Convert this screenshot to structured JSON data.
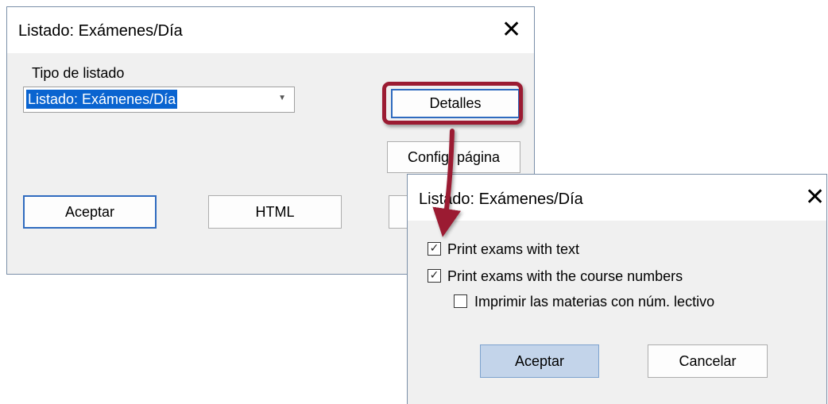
{
  "dialog1": {
    "title": "Listado: Exámenes/Día",
    "close_glyph": "✕",
    "type_label": "Tipo de listado",
    "combo_value": "Listado: Exámenes/Día",
    "combo_arrow": "▼",
    "details_button": "Detalles",
    "config_button": "Config. página",
    "accept_button": "Aceptar",
    "html_button": "HTML"
  },
  "dialog2": {
    "title": "Listado: Exámenes/Día",
    "close_glyph": "✕",
    "options": [
      {
        "label": "Print exams with text",
        "checked": true
      },
      {
        "label": "Print exams with the course numbers",
        "checked": true
      },
      {
        "label": "Imprimir las materias con núm. lectivo",
        "checked": false
      }
    ],
    "accept_button": "Aceptar",
    "cancel_button": "Cancelar"
  },
  "annotation": {
    "color": "#9b1b32",
    "highlight_target": "Detalles"
  }
}
